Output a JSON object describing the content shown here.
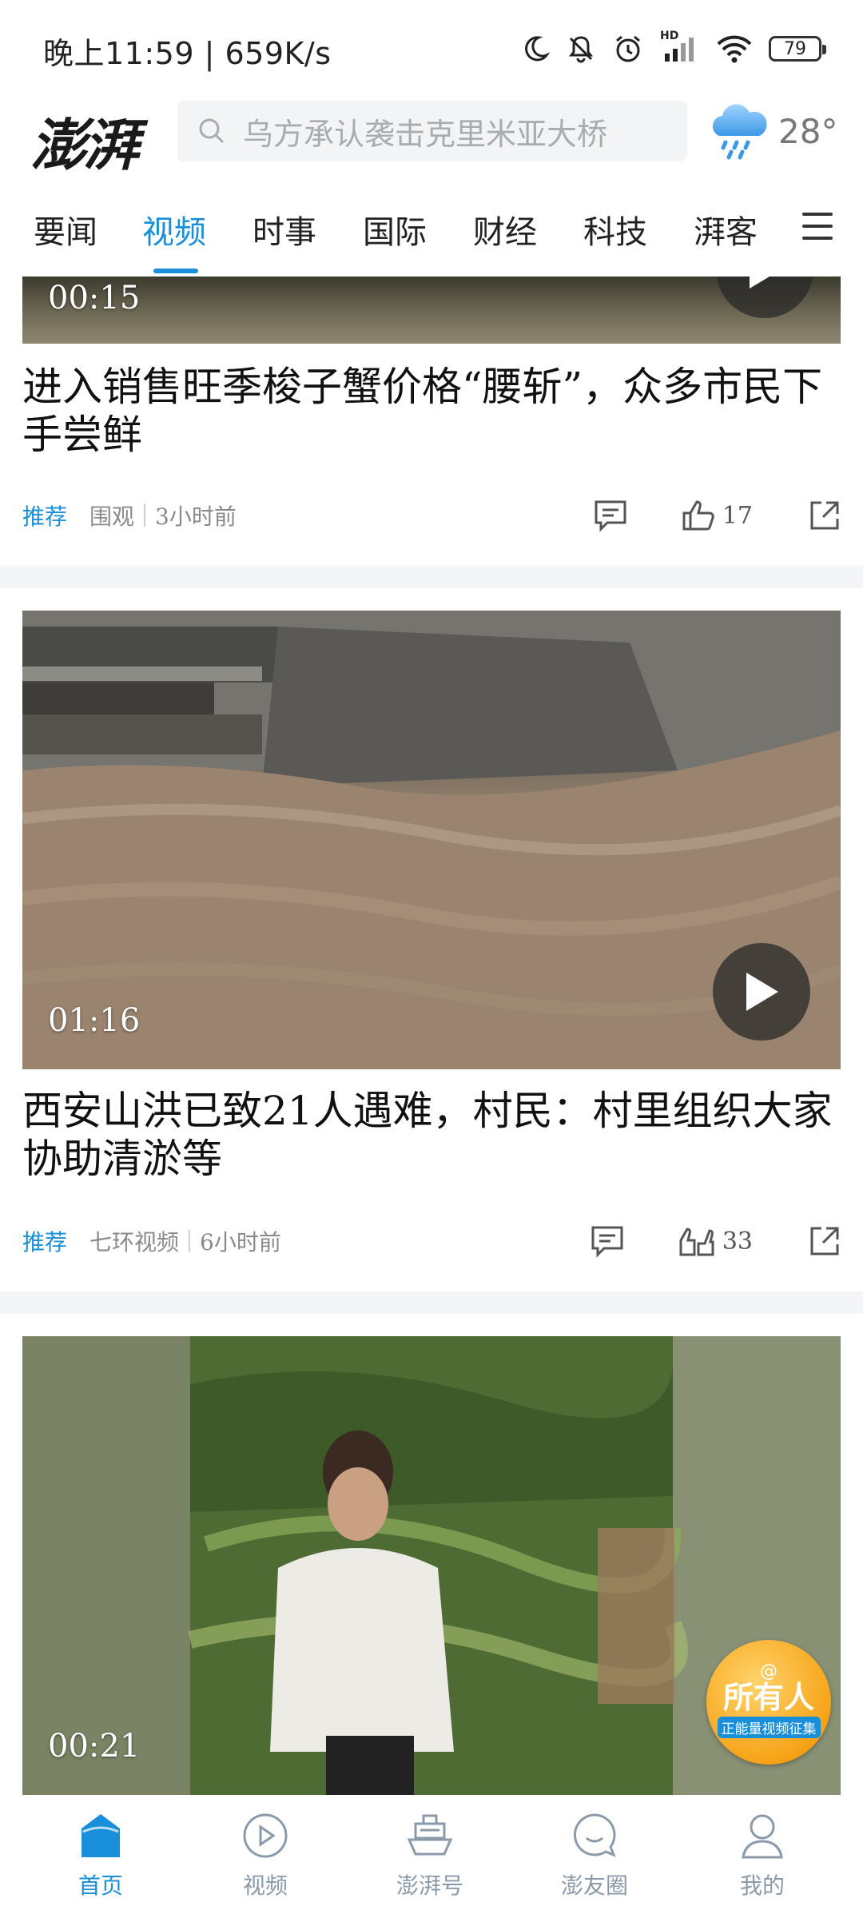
{
  "status_bar": {
    "time": "晚上11:59 | 659K/s",
    "battery": "79",
    "signal_label": "HD"
  },
  "header": {
    "logo": "澎湃",
    "search_placeholder": "乌方承认袭击克里米亚大桥",
    "weather_temp": "28°",
    "weather_icon": "rain-cloud-icon"
  },
  "nav": {
    "tabs": [
      "要闻",
      "视频",
      "时事",
      "国际",
      "财经",
      "科技",
      "湃客"
    ],
    "active_tab": "视频"
  },
  "feed": {
    "cards": [
      {
        "duration": "00:15",
        "title": "进入销售旺季梭子蟹价格“腰斩”，众多市民下手尝鲜",
        "tag": "推荐",
        "source": "围观",
        "time": "3小时前",
        "likes": "17"
      },
      {
        "duration": "01:16",
        "title": "西安山洪已致21人遇难，村民：村里组织大家协助清淤等",
        "tag": "推荐",
        "source": "七环视频",
        "time": "6小时前",
        "likes": "33"
      },
      {
        "duration": "00:21",
        "badge_main": "所有人",
        "badge_sub": "正能量视频征集"
      }
    ]
  },
  "tabbar": {
    "tabs": [
      "首页",
      "视频",
      "澎湃号",
      "澎友圈",
      "我的"
    ],
    "active_tab": "首页"
  },
  "colors": {
    "accent": "#1a8fd9",
    "muted_text": "#8a8a8a",
    "tab_inactive": "#8a9aa8"
  }
}
